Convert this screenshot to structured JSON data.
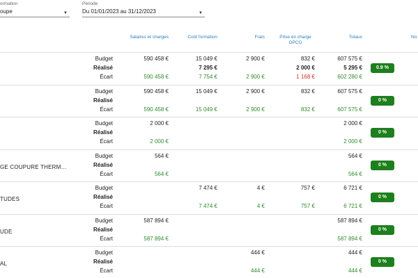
{
  "filters": {
    "formation": {
      "label": "ormation",
      "value": "oupe"
    },
    "periode": {
      "label": "Période",
      "value": "Du 01/01/2023 au 31/12/2023"
    }
  },
  "columns": {
    "salaires": "Salaires et charges",
    "cout": "Coût formation",
    "frais": "Frais",
    "opco_1": "Prise en charge",
    "opco_2": "OPCO",
    "totaux": "Totaux",
    "nonsub_1": "No",
    "nonsub_2": "s"
  },
  "row_labels": {
    "budget": "Budget",
    "realise": "Réalisé",
    "ecart": "Écart"
  },
  "groups": [
    {
      "name": "",
      "budget": {
        "sal": "590 458 €",
        "cout": "15 049 €",
        "frais": "2 900 €",
        "opco": "832 €",
        "tot": "607 575 €"
      },
      "realise": {
        "sal": "",
        "cout": "7 295 €",
        "frais": "",
        "opco": "2 000 €",
        "tot": "5 295 €"
      },
      "ecart": {
        "sal": "590 458 €",
        "cout": "7 754 €",
        "frais": "2 900 €",
        "opco": "1 168 €",
        "tot": "602 280 €"
      },
      "badge": "0.9 %"
    },
    {
      "name": "",
      "budget": {
        "sal": "590 458 €",
        "cout": "15 049 €",
        "frais": "2 900 €",
        "opco": "832 €",
        "tot": "607 575 €"
      },
      "realise": {
        "sal": "",
        "cout": "",
        "frais": "",
        "opco": "",
        "tot": ""
      },
      "ecart": {
        "sal": "590 458 €",
        "cout": "15 049 €",
        "frais": "2 900 €",
        "opco": "832 €",
        "tot": "607 575 €"
      },
      "badge": "0 %"
    },
    {
      "name": "",
      "budget": {
        "sal": "2 000 €",
        "cout": "",
        "frais": "",
        "opco": "",
        "tot": "2 000 €"
      },
      "realise": {
        "sal": "",
        "cout": "",
        "frais": "",
        "opco": "",
        "tot": ""
      },
      "ecart": {
        "sal": "2 000 €",
        "cout": "",
        "frais": "",
        "opco": "",
        "tot": "2 000 €"
      },
      "badge": "0 %"
    },
    {
      "name": "GE COUPURE THERM…",
      "budget": {
        "sal": "564 €",
        "cout": "",
        "frais": "",
        "opco": "",
        "tot": "564 €"
      },
      "realise": {
        "sal": "",
        "cout": "",
        "frais": "",
        "opco": "",
        "tot": ""
      },
      "ecart": {
        "sal": "564 €",
        "cout": "",
        "frais": "",
        "opco": "",
        "tot": "564 €"
      },
      "badge": "0 %"
    },
    {
      "name": "TUDES",
      "budget": {
        "sal": "",
        "cout": "7 474 €",
        "frais": "4 €",
        "opco": "757 €",
        "tot": "6 721 €"
      },
      "realise": {
        "sal": "",
        "cout": "",
        "frais": "",
        "opco": "",
        "tot": ""
      },
      "ecart": {
        "sal": "",
        "cout": "7 474 €",
        "frais": "4 €",
        "opco": "757 €",
        "tot": "6 721 €"
      },
      "badge": "0 %"
    },
    {
      "name": "UDE",
      "budget": {
        "sal": "587 894 €",
        "cout": "",
        "frais": "",
        "opco": "",
        "tot": "587 894 €"
      },
      "realise": {
        "sal": "",
        "cout": "",
        "frais": "",
        "opco": "",
        "tot": ""
      },
      "ecart": {
        "sal": "587 894 €",
        "cout": "",
        "frais": "",
        "opco": "",
        "tot": "587 894 €"
      },
      "badge": "0 %"
    },
    {
      "name": "AL",
      "budget": {
        "sal": "",
        "cout": "",
        "frais": "444 €",
        "opco": "",
        "tot": "444 €"
      },
      "realise": {
        "sal": "",
        "cout": "",
        "frais": "",
        "opco": "",
        "tot": ""
      },
      "ecart": {
        "sal": "",
        "cout": "",
        "frais": "444 €",
        "opco": "",
        "tot": "444 €"
      },
      "badge": "0 %"
    }
  ],
  "colors": {
    "accent": "#2a7fb8",
    "positive": "#2e8b2e",
    "negative": "#d32f2f",
    "badge": "#1d7f1d"
  },
  "icons": {
    "dropdown": "caret-down-icon"
  }
}
